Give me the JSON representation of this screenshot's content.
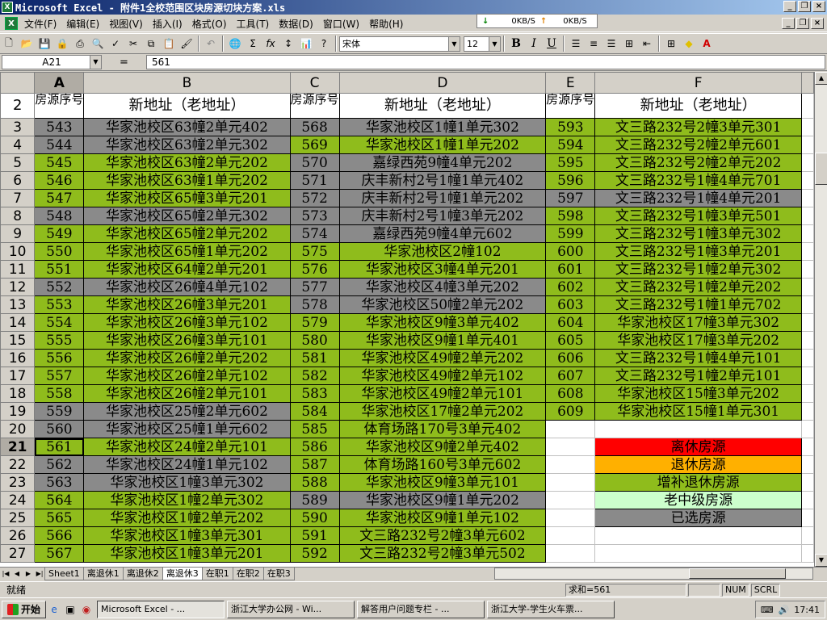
{
  "window": {
    "title": "Microsoft Excel - 附件1全校范围区块房源切块方案.xls"
  },
  "netmon": {
    "down": "0KB/S",
    "up": "0KB/S"
  },
  "menu": [
    "文件(F)",
    "编辑(E)",
    "视图(V)",
    "插入(I)",
    "格式(O)",
    "工具(T)",
    "数据(D)",
    "窗口(W)",
    "帮助(H)"
  ],
  "toolbar": {
    "font": "宋体",
    "size": "12",
    "bold": "B",
    "italic": "I",
    "underline": "U",
    "sigma": "Σ",
    "fx": "fx"
  },
  "formula": {
    "namebox": "A21",
    "eq": "=",
    "value": "561"
  },
  "columns": [
    "A",
    "B",
    "C",
    "D",
    "E",
    "F"
  ],
  "header_row": {
    "rownum": "2",
    "a": "房源序号",
    "b": "新地址（老地址）",
    "c": "房源序号",
    "d": "新地址（老地址）",
    "e": "房源序号",
    "f": "新地址（老地址）"
  },
  "rows": [
    {
      "n": "3",
      "a": "543",
      "b": "华家池校区63幢2单元402",
      "c": "568",
      "d": "华家池校区1幢1单元302",
      "e": "593",
      "f": "文三路232号2幢3单元301"
    },
    {
      "n": "4",
      "a": "544",
      "b": "华家池校区63幢2单元302",
      "c": "569",
      "d": "华家池校区1幢1单元202",
      "e": "594",
      "f": "文三路232号2幢2单元601"
    },
    {
      "n": "5",
      "a": "545",
      "b": "华家池校区63幢2单元202",
      "c": "570",
      "d": "嘉绿西苑9幢4单元202",
      "e": "595",
      "f": "文三路232号2幢2单元202"
    },
    {
      "n": "6",
      "a": "546",
      "b": "华家池校区63幢1单元202",
      "c": "571",
      "d": "庆丰新村2号1幢1单元402",
      "e": "596",
      "f": "文三路232号1幢4单元701"
    },
    {
      "n": "7",
      "a": "547",
      "b": "华家池校区65幢3单元201",
      "c": "572",
      "d": "庆丰新村2号1幢1单元202",
      "e": "597",
      "f": "文三路232号1幢4单元201"
    },
    {
      "n": "8",
      "a": "548",
      "b": "华家池校区65幢2单元302",
      "c": "573",
      "d": "庆丰新村2号1幢3单元202",
      "e": "598",
      "f": "文三路232号1幢3单元501"
    },
    {
      "n": "9",
      "a": "549",
      "b": "华家池校区65幢2单元202",
      "c": "574",
      "d": "嘉绿西苑9幢4单元602",
      "e": "599",
      "f": "文三路232号1幢3单元302"
    },
    {
      "n": "10",
      "a": "550",
      "b": "华家池校区65幢1单元202",
      "c": "575",
      "d": "华家池校区2幢102",
      "e": "600",
      "f": "文三路232号1幢3单元201"
    },
    {
      "n": "11",
      "a": "551",
      "b": "华家池校区64幢2单元201",
      "c": "576",
      "d": "华家池校区3幢4单元201",
      "e": "601",
      "f": "文三路232号1幢2单元302"
    },
    {
      "n": "12",
      "a": "552",
      "b": "华家池校区26幢4单元102",
      "c": "577",
      "d": "华家池校区4幢3单元202",
      "e": "602",
      "f": "文三路232号1幢2单元202"
    },
    {
      "n": "13",
      "a": "553",
      "b": "华家池校区26幢3单元201",
      "c": "578",
      "d": "华家池校区50幢2单元202",
      "e": "603",
      "f": "文三路232号1幢1单元702"
    },
    {
      "n": "14",
      "a": "554",
      "b": "华家池校区26幢3单元102",
      "c": "579",
      "d": "华家池校区9幢3单元402",
      "e": "604",
      "f": "华家池校区17幢3单元302"
    },
    {
      "n": "15",
      "a": "555",
      "b": "华家池校区26幢3单元101",
      "c": "580",
      "d": "华家池校区9幢1单元401",
      "e": "605",
      "f": "华家池校区17幢3单元202"
    },
    {
      "n": "16",
      "a": "556",
      "b": "华家池校区26幢2单元202",
      "c": "581",
      "d": "华家池校区49幢2单元202",
      "e": "606",
      "f": "文三路232号1幢4单元101"
    },
    {
      "n": "17",
      "a": "557",
      "b": "华家池校区26幢2单元102",
      "c": "582",
      "d": "华家池校区49幢2单元102",
      "e": "607",
      "f": "文三路232号1幢2单元101"
    },
    {
      "n": "18",
      "a": "558",
      "b": "华家池校区26幢2单元101",
      "c": "583",
      "d": "华家池校区49幢2单元101",
      "e": "608",
      "f": "华家池校区15幢3单元202"
    },
    {
      "n": "19",
      "a": "559",
      "b": "华家池校区25幢2单元602",
      "c": "584",
      "d": "华家池校区17幢2单元202",
      "e": "609",
      "f": "华家池校区15幢1单元301"
    },
    {
      "n": "20",
      "a": "560",
      "b": "华家池校区25幢1单元602",
      "c": "585",
      "d": "体育场路170号3单元402",
      "e": "",
      "f": ""
    },
    {
      "n": "21",
      "a": "561",
      "b": "华家池校区24幢2单元101",
      "c": "586",
      "d": "华家池校区9幢2单元402",
      "e": "",
      "f": "离休房源"
    },
    {
      "n": "22",
      "a": "562",
      "b": "华家池校区24幢1单元102",
      "c": "587",
      "d": "体育场路160号3单元602",
      "e": "",
      "f": "退休房源"
    },
    {
      "n": "23",
      "a": "563",
      "b": "华家池校区1幢3单元302",
      "c": "588",
      "d": "华家池校区9幢3单元101",
      "e": "",
      "f": "增补退休房源"
    },
    {
      "n": "24",
      "a": "564",
      "b": "华家池校区1幢2单元302",
      "c": "589",
      "d": "华家池校区9幢1单元202",
      "e": "",
      "f": "老中级房源"
    },
    {
      "n": "25",
      "a": "565",
      "b": "华家池校区1幢2单元202",
      "c": "590",
      "d": "华家池校区9幢1单元102",
      "e": "",
      "f": "已选房源"
    },
    {
      "n": "26",
      "a": "566",
      "b": "华家池校区1幢3单元301",
      "c": "591",
      "d": "文三路232号2幢3单元602",
      "e": "",
      "f": ""
    },
    {
      "n": "27",
      "a": "567",
      "b": "华家池校区1幢3单元201",
      "c": "592",
      "d": "文三路232号2幢3单元502",
      "e": "",
      "f": ""
    }
  ],
  "colors": {
    "green": "#8fbc1c",
    "gray": "#8a8a8a",
    "red": "#ff0000",
    "orange": "#ffb000",
    "pale": "#ccffcc"
  },
  "tabs": [
    "Sheet1",
    "离退休1",
    "离退休2",
    "离退休3",
    "在职1",
    "在职2",
    "在职3"
  ],
  "active_tab": "离退休3",
  "status": {
    "ready": "就绪",
    "sum": "求和=561",
    "num": "NUM",
    "scrl": "SCRL"
  },
  "taskbar": {
    "start": "开始",
    "buttons": [
      "Microsoft Excel - ...",
      "浙江大学办公网 - Wi...",
      "解答用户问题专栏 - ...",
      "浙江大学-学生火车票..."
    ],
    "clock": "17:41"
  }
}
